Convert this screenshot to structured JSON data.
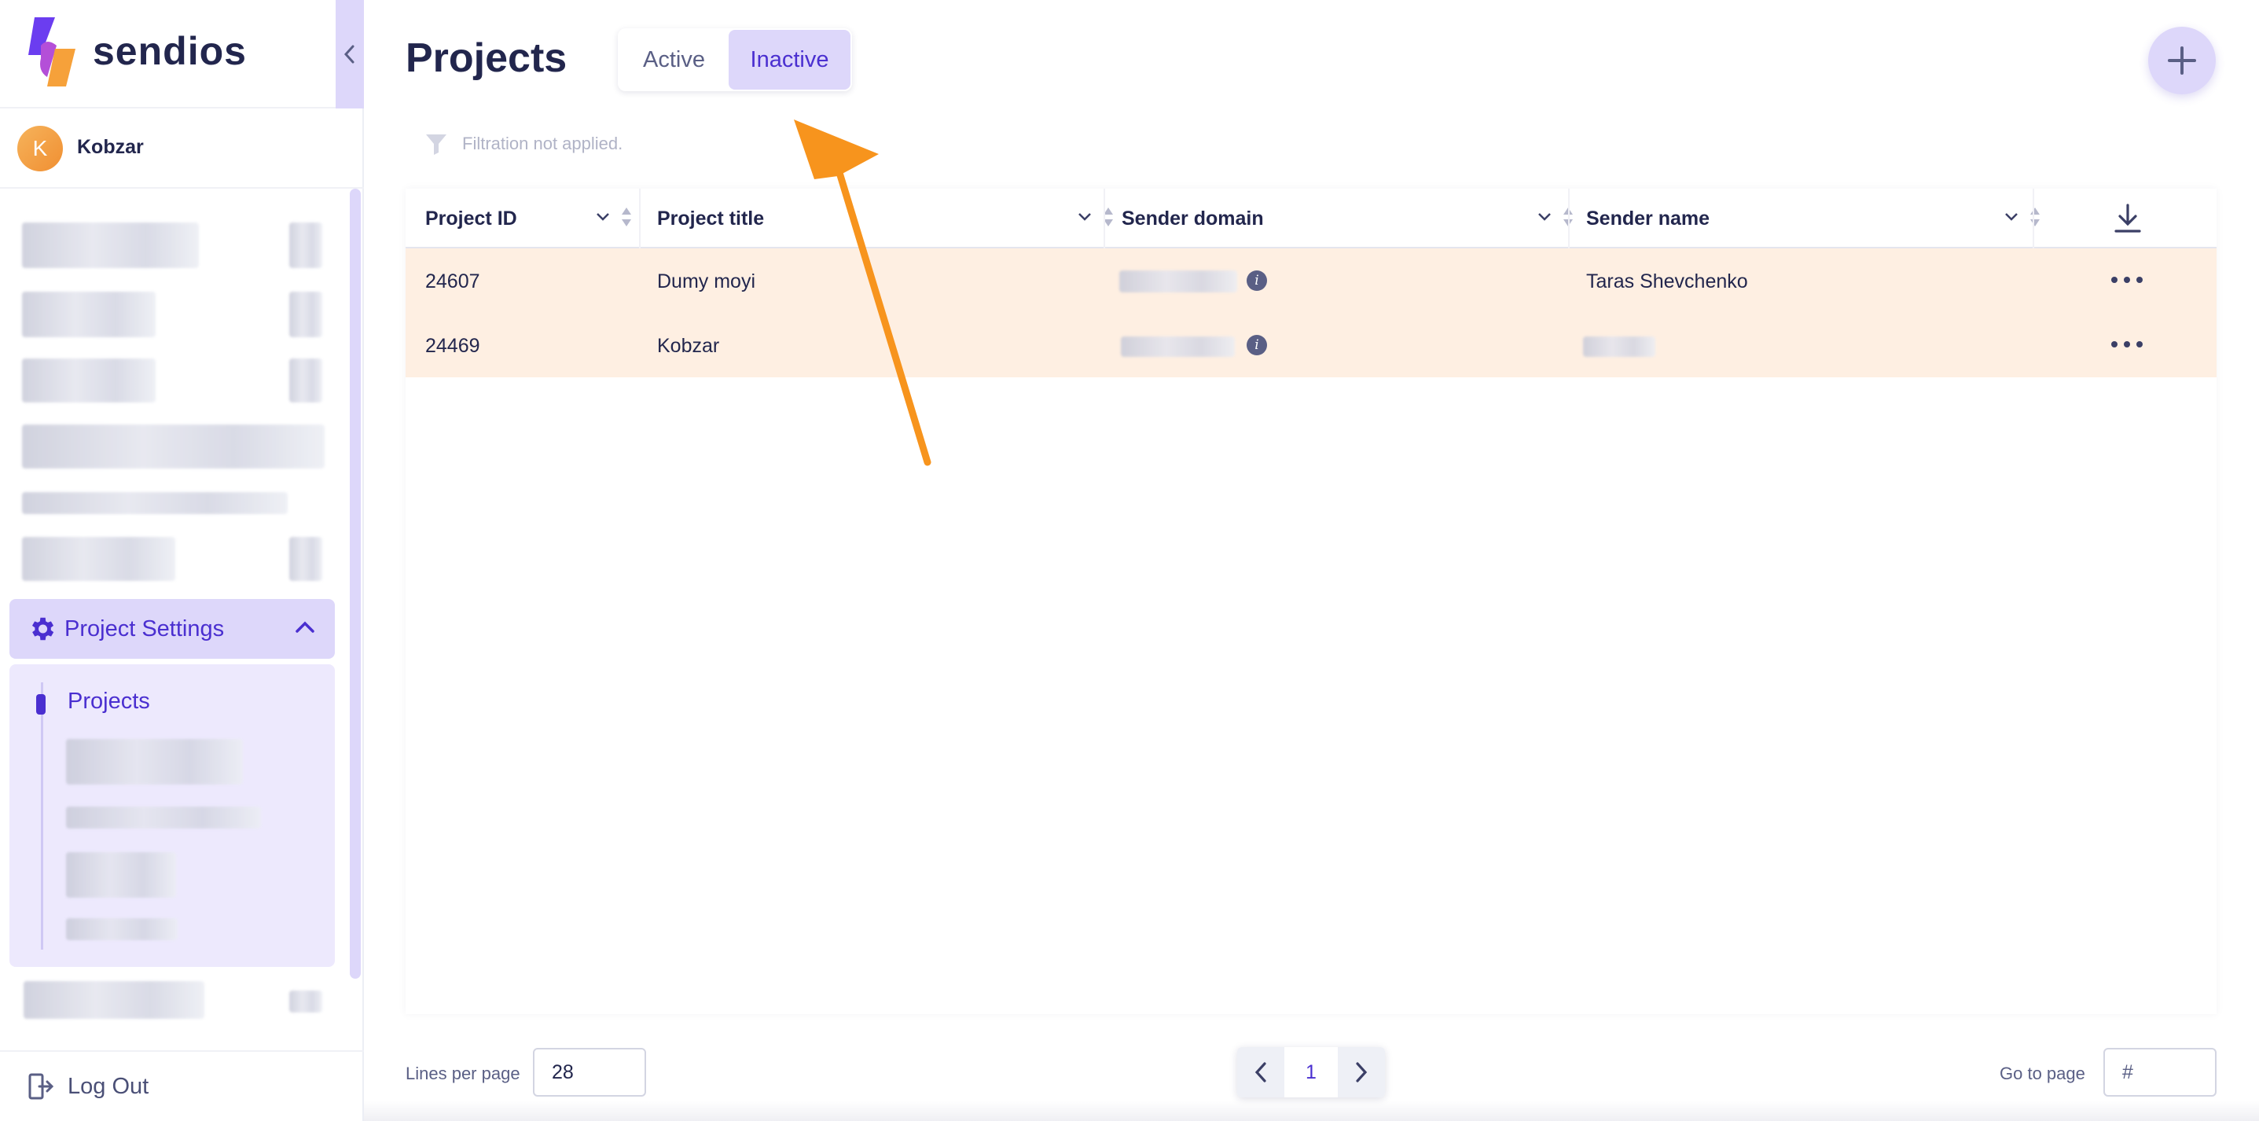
{
  "app": {
    "brand": "sendios",
    "collapse_icon": "chevron-left-icon"
  },
  "user": {
    "initial": "K",
    "name": "Kobzar"
  },
  "sidebar": {
    "section": {
      "label": "Project Settings",
      "icon": "gear-icon",
      "expanded": true
    },
    "active_item": "Projects",
    "logout_label": "Log Out"
  },
  "page": {
    "title": "Projects",
    "tabs": {
      "active": "Active",
      "inactive": "Inactive",
      "selected": "Inactive"
    },
    "filter_text": "Filtration not applied."
  },
  "table": {
    "columns": [
      "Project ID",
      "Project title",
      "Sender domain",
      "Sender name"
    ],
    "rows": [
      {
        "id": "24607",
        "title": "Dumy moyi",
        "sender_name": "Taras Shevchenko"
      },
      {
        "id": "24469",
        "title": "Kobzar",
        "sender_name": ""
      }
    ]
  },
  "footer": {
    "lines_label": "Lines per page",
    "lines_value": "28",
    "page": "1",
    "goto_label": "Go to page",
    "goto_placeholder": "#"
  },
  "colors": {
    "accent": "#4a2fd0",
    "accent_light": "#ddd7fa",
    "row_highlight": "#feefe2",
    "annotation_arrow": "#f7941d"
  }
}
